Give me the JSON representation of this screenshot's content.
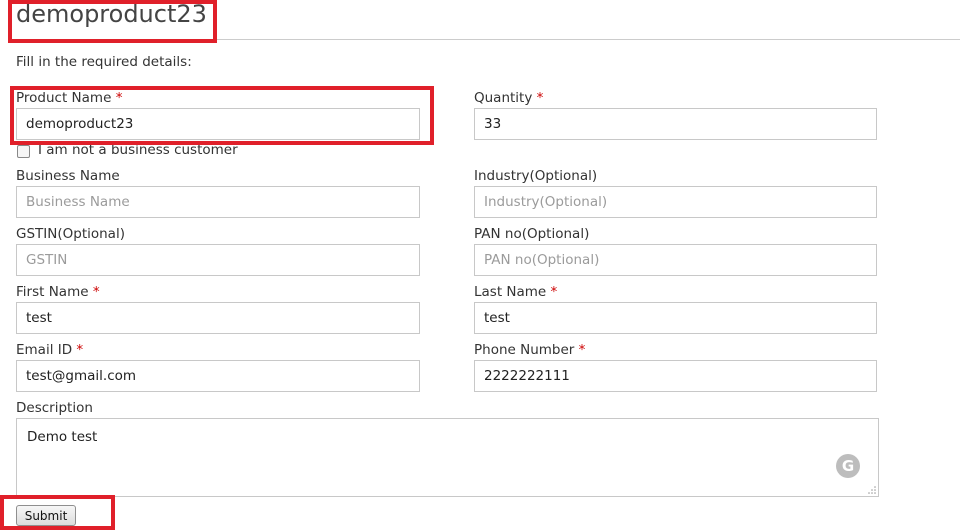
{
  "page": {
    "title": "demoproduct23",
    "intro": "Fill in the required details:"
  },
  "required_marker": "*",
  "form": {
    "product_name": {
      "label": "Product Name",
      "value": "demoproduct23",
      "required": true
    },
    "quantity": {
      "label": "Quantity",
      "value": "33",
      "required": true
    },
    "not_business_checkbox": {
      "label": "I am not a business customer",
      "checked": false
    },
    "business_name": {
      "label": "Business Name",
      "value": "",
      "placeholder": "Business Name"
    },
    "industry": {
      "label": "Industry(Optional)",
      "value": "",
      "placeholder": "Industry(Optional)"
    },
    "gstin": {
      "label": "GSTIN(Optional)",
      "value": "",
      "placeholder": "GSTIN"
    },
    "pan": {
      "label": "PAN no(Optional)",
      "value": "",
      "placeholder": "PAN no(Optional)"
    },
    "first_name": {
      "label": "First Name",
      "value": "test",
      "required": true
    },
    "last_name": {
      "label": "Last Name",
      "value": "test",
      "required": true
    },
    "email": {
      "label": "Email ID",
      "value": "test@gmail.com",
      "required": true
    },
    "phone": {
      "label": "Phone Number",
      "value": "2222222111",
      "required": true
    },
    "description": {
      "label": "Description",
      "value": "Demo test"
    },
    "submit_label": "Submit"
  },
  "icons": {
    "grammarly": "grammarly-icon",
    "resize": "resize-grip-icon"
  },
  "colors": {
    "highlight": "#e0202a",
    "required": "#cc0000"
  }
}
